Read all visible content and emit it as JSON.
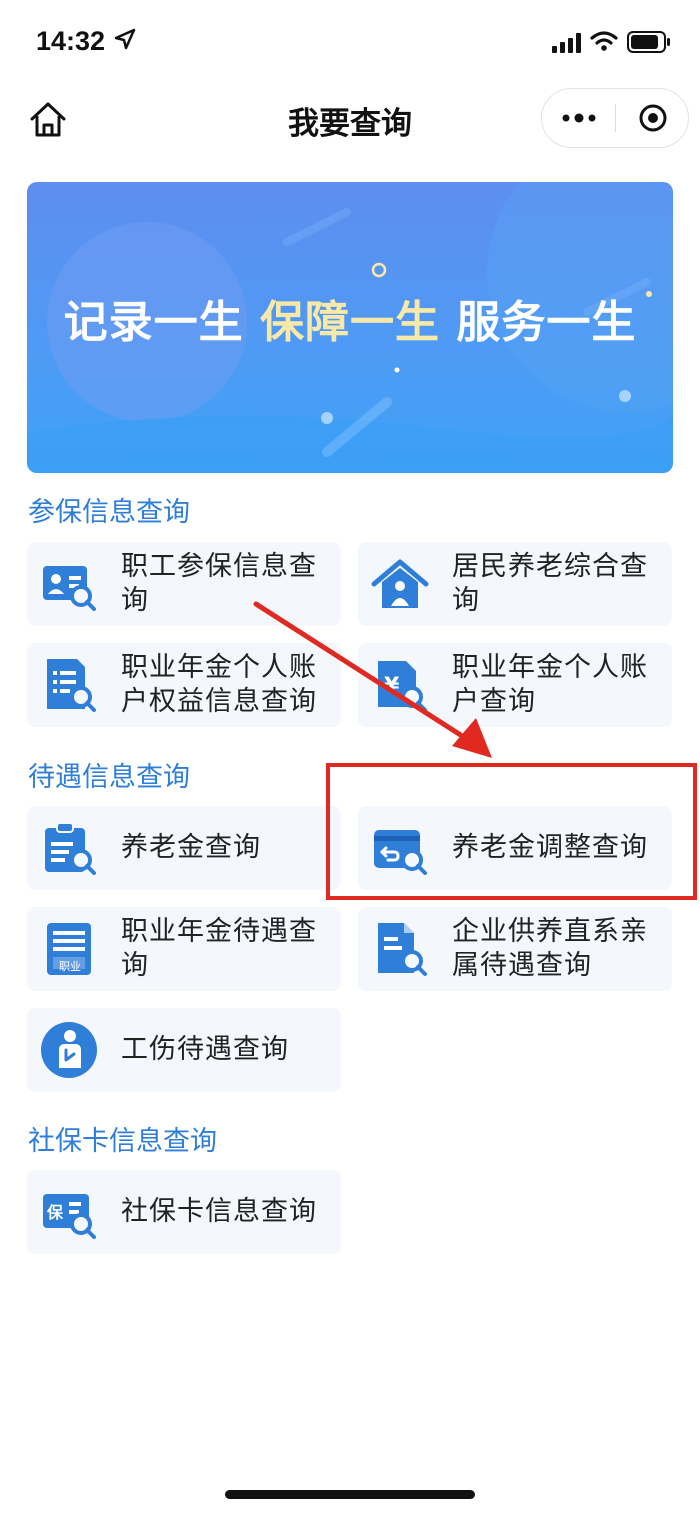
{
  "status_bar": {
    "time": "14:32",
    "icons": [
      "location-arrow-icon",
      "cellular-signal-icon",
      "wifi-icon",
      "battery-icon"
    ]
  },
  "nav": {
    "title": "我要查询",
    "home_icon": "home-icon",
    "more_icon": "more-dots-icon",
    "close_icon": "target-close-icon"
  },
  "banner": {
    "slogan_part1": "记录一生",
    "slogan_part2": "保障一生",
    "slogan_part3": "服务一生"
  },
  "sections": [
    {
      "title": "参保信息查询",
      "items": [
        {
          "label": "职工参保信息查询",
          "icon": "id-card-search-icon"
        },
        {
          "label": "居民养老综合查询",
          "icon": "house-person-icon"
        },
        {
          "label": "职业年金个人账户权益信息查询",
          "icon": "document-list-search-icon"
        },
        {
          "label": "职业年金个人账户查询",
          "icon": "yuan-document-search-icon"
        }
      ]
    },
    {
      "title": "待遇信息查询",
      "items": [
        {
          "label": "养老金查询",
          "icon": "clipboard-search-icon"
        },
        {
          "label": "养老金调整查询",
          "icon": "card-return-search-icon"
        },
        {
          "label": "职业年金待遇查询",
          "icon": "occupation-document-icon",
          "icon_text": "职业"
        },
        {
          "label": "企业供养直系亲属待遇查询",
          "icon": "file-search-icon"
        },
        {
          "label": "工伤待遇查询",
          "icon": "injured-person-icon"
        }
      ]
    },
    {
      "title": "社保卡信息查询",
      "items": [
        {
          "label": "社保卡信息查询",
          "icon": "insurance-card-search-icon",
          "icon_text": "保"
        }
      ]
    }
  ],
  "colors": {
    "accent": "#2f7ed8",
    "card_bg": "#f4f8fd",
    "annotation_red": "#e02a21",
    "banner_top": "#5e8ef0",
    "banner_bottom": "#3fa3f6"
  }
}
